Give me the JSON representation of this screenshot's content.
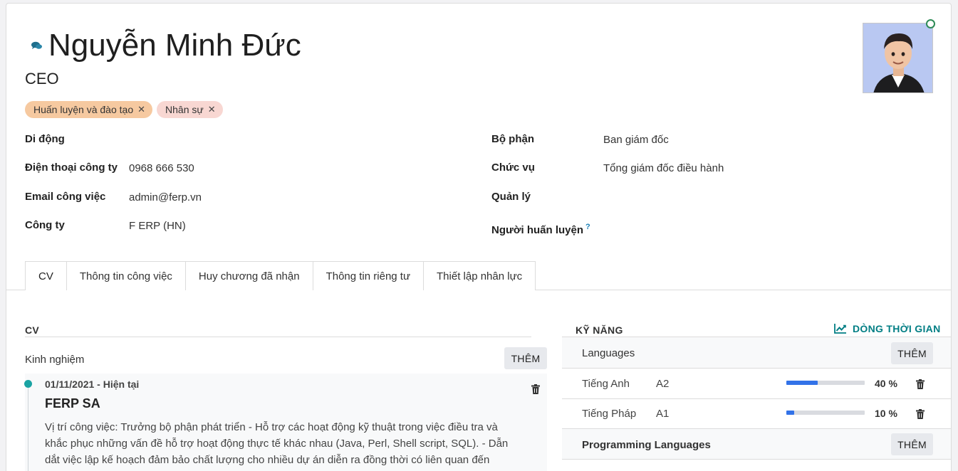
{
  "employee": {
    "name": "Nguyễn Minh Đức",
    "job_title": "CEO",
    "tags": [
      {
        "label": "Huấn luyện và đào tạo",
        "color": "#f6c9a0"
      },
      {
        "label": "Nhân sự",
        "color": "#f8d7d2"
      }
    ],
    "status_color": "#2e8b57"
  },
  "fields_left": [
    {
      "label": "Di động",
      "value": ""
    },
    {
      "label": "Điện thoại công ty",
      "value": "0968 666 530"
    },
    {
      "label": "Email công việc",
      "value": "admin@ferp.vn"
    },
    {
      "label": "Công ty",
      "value": "F ERP (HN)"
    }
  ],
  "fields_right": [
    {
      "label": "Bộ phận",
      "value": "Ban giám đốc"
    },
    {
      "label": "Chức vụ",
      "value": "Tổng giám đốc điều hành"
    },
    {
      "label": "Quản lý",
      "value": ""
    },
    {
      "label": "Người huấn luyện",
      "value": "",
      "help": "?"
    }
  ],
  "tabs": [
    "CV",
    "Thông tin công việc",
    "Huy chương đã nhận",
    "Thông tin riêng tư",
    "Thiết lập nhân lực"
  ],
  "resume": {
    "section_title": "CV",
    "group_label": "Kinh nghiệm",
    "add_label": "THÊM",
    "entries": [
      {
        "date": "01/11/2021 - Hiện tại",
        "company": "FERP SA",
        "description": "Vị trí công việc: Trưởng bộ phận phát triển - Hỗ trợ các hoạt động kỹ thuật trong việc điều tra và khắc phục những vấn đề hỗ trợ hoạt động thực tế khác nhau (Java, Perl, Shell script, SQL). - Dẫn dắt việc lập kế hoạch đảm bảo chất lượng cho nhiều dự án diễn ra đồng thời có liên quan đến"
      }
    ]
  },
  "skills": {
    "section_title": "KỸ NĂNG",
    "timeline_label": "DÒNG THỜI GIAN",
    "accent": "#017e84",
    "bar_color": "#3272e8",
    "groups": [
      {
        "type": "Languages",
        "add_label": "THÊM",
        "items": [
          {
            "name": "Tiếng Anh",
            "level": "A2",
            "progress": 40,
            "progress_label": "40 %"
          },
          {
            "name": "Tiếng Pháp",
            "level": "A1",
            "progress": 10,
            "progress_label": "10 %"
          }
        ]
      },
      {
        "type": "Programming Languages",
        "add_label": "THÊM",
        "items": []
      }
    ]
  }
}
